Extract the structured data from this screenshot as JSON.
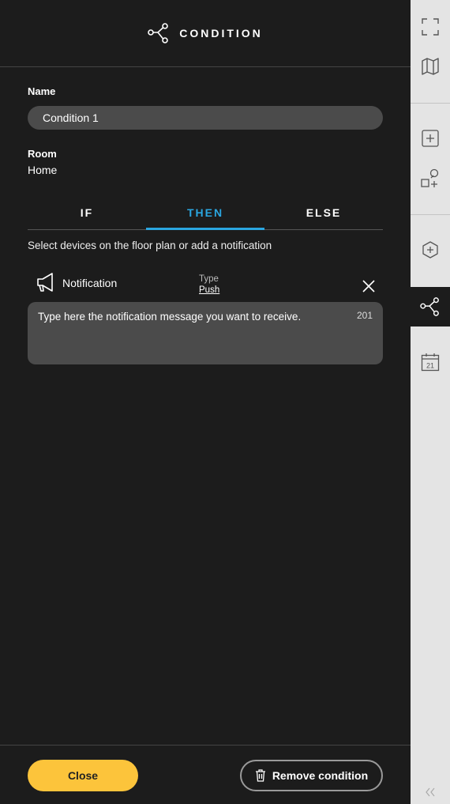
{
  "header": {
    "title": "CONDITION",
    "icon": "condition-branch-icon"
  },
  "form": {
    "name_label": "Name",
    "name_value": "Condition 1",
    "room_label": "Room",
    "room_value": "Home"
  },
  "tabs": [
    {
      "label": "IF",
      "active": false
    },
    {
      "label": "THEN",
      "active": true
    },
    {
      "label": "ELSE",
      "active": false
    }
  ],
  "hint": "Select devices on the floor plan or add a notification",
  "notification": {
    "icon": "megaphone-icon",
    "label": "Notification",
    "type_label": "Type",
    "type_value": "Push",
    "message": "Type here the notification message you want to receive.",
    "char_count": "201"
  },
  "footer": {
    "close_label": "Close",
    "remove_label": "Remove condition"
  },
  "sidebar": {
    "items": [
      {
        "icon": "fullscreen-icon"
      },
      {
        "icon": "map-icon"
      },
      {
        "icon": "add-square-icon"
      },
      {
        "icon": "add-shapes-icon"
      },
      {
        "icon": "add-hexagon-icon"
      },
      {
        "icon": "condition-branch-icon",
        "active": true
      },
      {
        "icon": "calendar-icon",
        "label": "21"
      }
    ],
    "collapse_icon": "double-chevron-left-icon"
  },
  "colors": {
    "accent": "#2aa6e0",
    "primary_button": "#fcc43b",
    "panel_bg": "#1c1c1c",
    "sidebar_bg": "#e4e4e4"
  }
}
